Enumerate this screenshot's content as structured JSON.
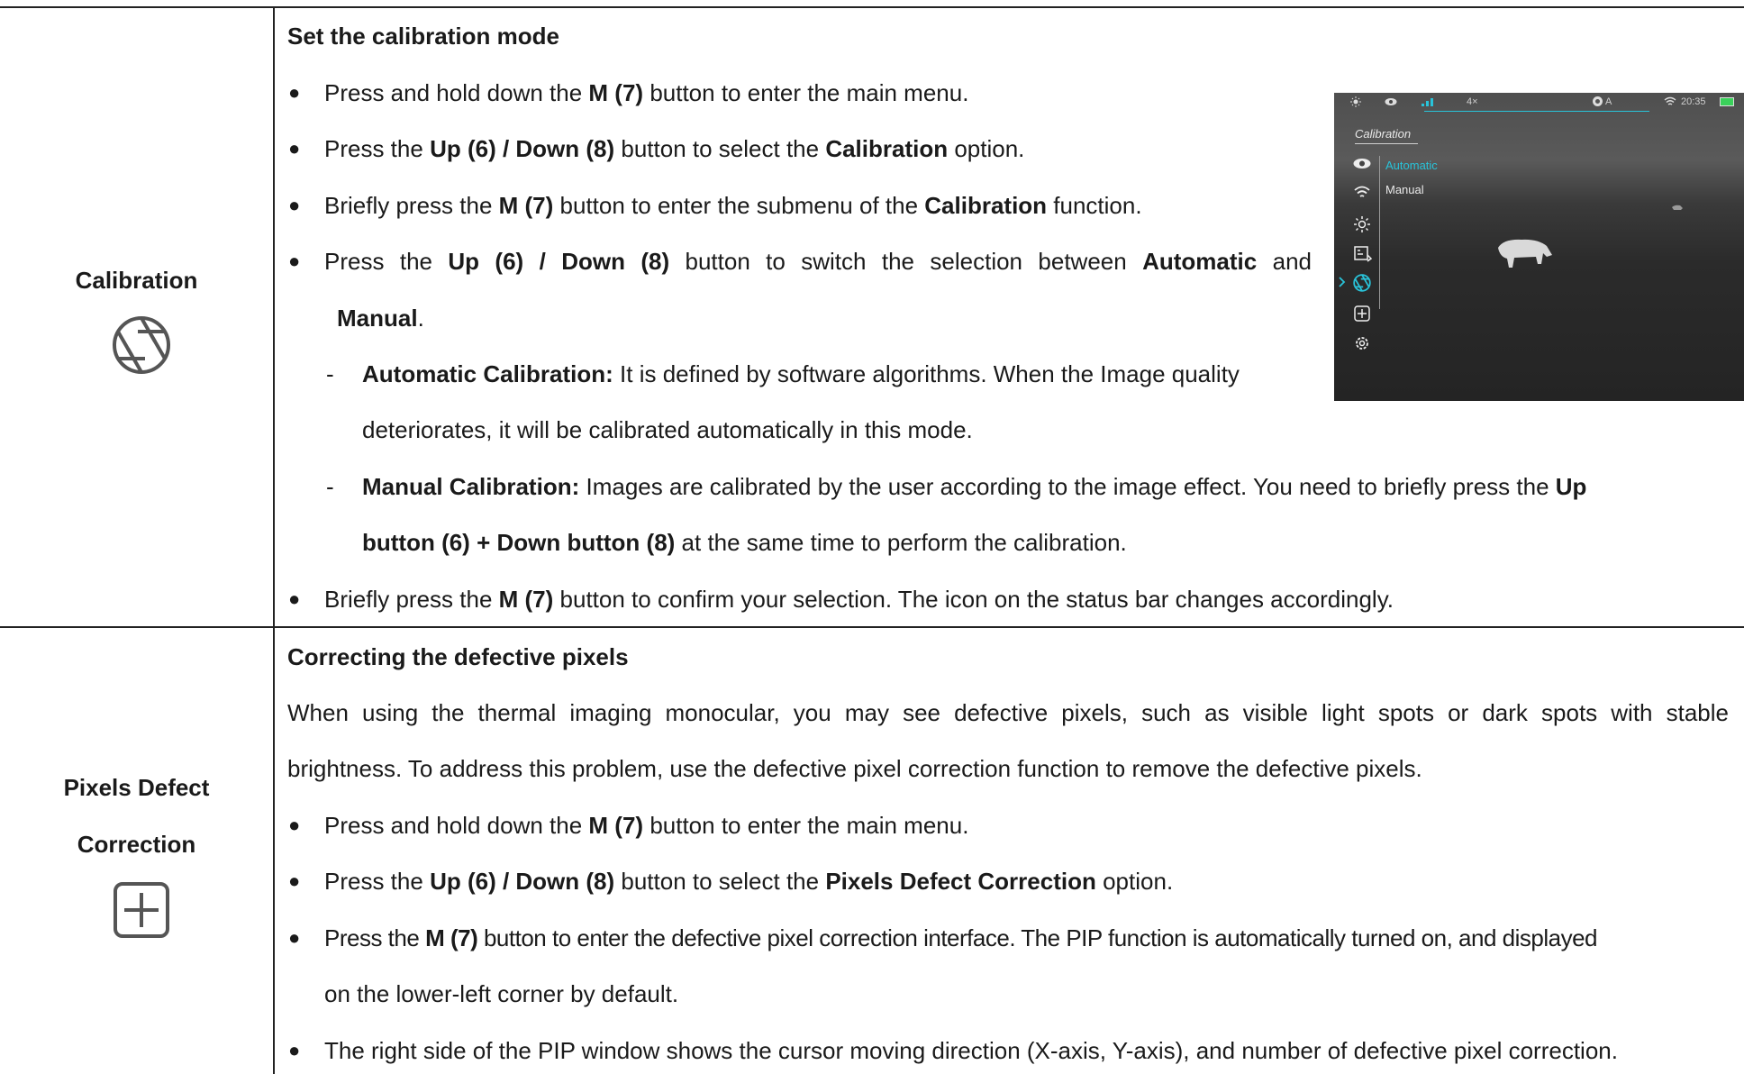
{
  "calibration": {
    "label": "Calibration",
    "heading": "Set the calibration mode",
    "b1": {
      "p1": "Press and hold down the ",
      "k1": "M (7)",
      "p2": " button to enter the main menu."
    },
    "b2": {
      "p1": "Press the ",
      "k1": "Up (6) / Down (8)",
      "p2": " button to select the ",
      "k2": "Calibration",
      "p3": " option."
    },
    "b3": {
      "p1": "Briefly press the ",
      "k1": "M (7)",
      "p2": " button to enter the submenu of the ",
      "k2": "Calibration",
      "p3": " function."
    },
    "b4": {
      "p1": "Press the ",
      "k1": "Up (6) / Down (8)",
      "p2": " button to switch the selection between ",
      "k2": "Automatic",
      "p3": " and",
      "k3": "Manual",
      "p4": "."
    },
    "auto": {
      "dash": "-",
      "k1": "Automatic Calibration:",
      "p1": " It is defined by software algorithms. When the Image quality",
      "p2": "deteriorates, it will be calibrated automatically in this mode."
    },
    "manual": {
      "dash": "-",
      "k1": "Manual Calibration:",
      "p1": " Images are calibrated by the user according to the image effect. You need to briefly press the ",
      "k2": "Up",
      "k3": "button (6) + Down button (8)",
      "p2": " at the same time to perform the calibration."
    },
    "b5": {
      "p1": "Briefly press the ",
      "k1": "M (7)",
      "p2": " button to confirm your selection. The icon on the status bar changes accordingly."
    }
  },
  "bullet_glyph": "●",
  "device_screen": {
    "zoom": "4×",
    "mode": "A",
    "time": "20:35",
    "menu_title": "Calibration",
    "options": [
      "Automatic",
      "Manual"
    ],
    "selected_color": "#29c3d9"
  },
  "pixels": {
    "label_line1": "Pixels Defect",
    "label_line2": "Correction",
    "heading": "Correcting the defective pixels",
    "intro1": "When using the thermal imaging monocular, you may see defective pixels, such as visible light spots or dark spots with stable",
    "intro2": "brightness. To address this problem, use the defective pixel correction function to remove the defective pixels.",
    "b1": {
      "p1": "Press and hold down the ",
      "k1": "M (7)",
      "p2": " button to enter the main menu."
    },
    "b2": {
      "p1": "Press the ",
      "k1": "Up (6) / Down (8)",
      "p2": " button to select the ",
      "k2": "Pixels Defect Correction",
      "p3": " option."
    },
    "b3": {
      "p1": "Press the ",
      "k1": "M (7)",
      "p2": " button to enter the defective pixel correction interface. The PIP function is automatically turned on, and displayed",
      "p3": "on the lower-left corner by default."
    },
    "b4": {
      "p1": "The right side of the PIP window shows the cursor moving direction (X-axis, Y-axis), and number of defective pixel correction."
    }
  }
}
